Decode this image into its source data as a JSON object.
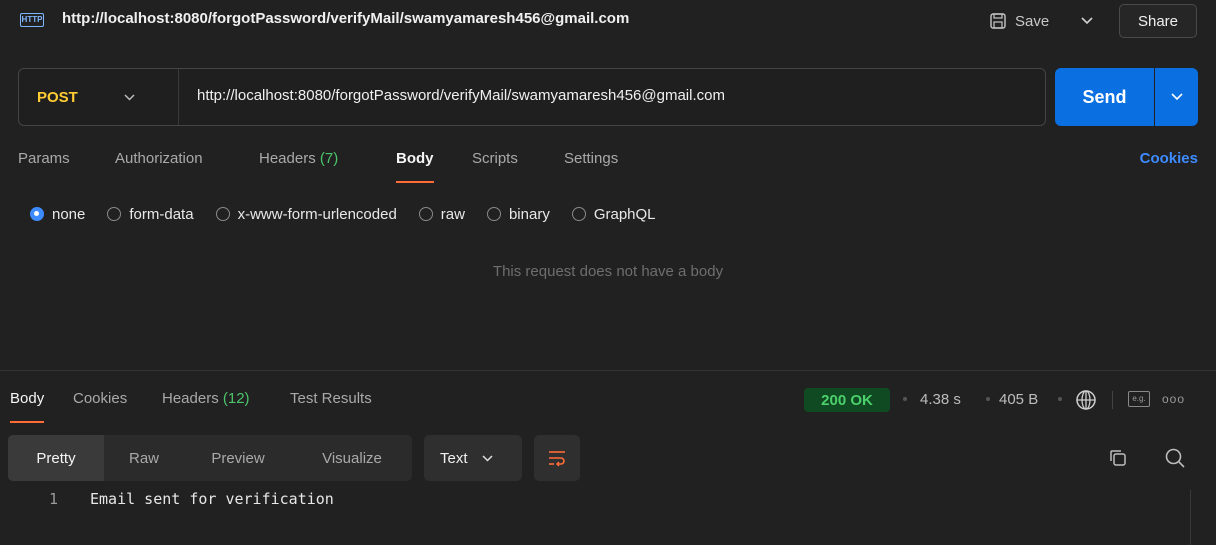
{
  "title_bar": {
    "badge": "HTTP",
    "url": "http://localhost:8080/forgotPassword/verifyMail/swamyamaresh456@gmail.com",
    "save_label": "Save",
    "share_label": "Share"
  },
  "request": {
    "method": "POST",
    "url": "http://localhost:8080/forgotPassword/verifyMail/swamyamaresh456@gmail.com",
    "send_label": "Send"
  },
  "request_tabs": {
    "params": "Params",
    "authorization": "Authorization",
    "headers": "Headers",
    "headers_count": "(7)",
    "body": "Body",
    "scripts": "Scripts",
    "settings": "Settings",
    "cookies": "Cookies"
  },
  "body_types": {
    "none": "none",
    "form_data": "form-data",
    "urlencoded": "x-www-form-urlencoded",
    "raw": "raw",
    "binary": "binary",
    "graphql": "GraphQL",
    "selected": "none"
  },
  "empty_body_message": "This request does not have a body",
  "response": {
    "tabs": {
      "body": "Body",
      "cookies": "Cookies",
      "headers": "Headers",
      "headers_count": "(12)",
      "test_results": "Test Results"
    },
    "status": "200 OK",
    "time": "4.38 s",
    "size": "405 B",
    "eg_label": "e.g.",
    "more": "ooo",
    "views": {
      "pretty": "Pretty",
      "raw": "Raw",
      "preview": "Preview",
      "visualize": "Visualize"
    },
    "format": "Text",
    "lines": [
      {
        "no": "1",
        "text": "Email sent for verification"
      }
    ]
  },
  "colors": {
    "accent_orange": "#ff6c37",
    "send_blue": "#0a6fe0",
    "method_yellow": "#ffcc33",
    "status_green": "#4cd06b"
  }
}
